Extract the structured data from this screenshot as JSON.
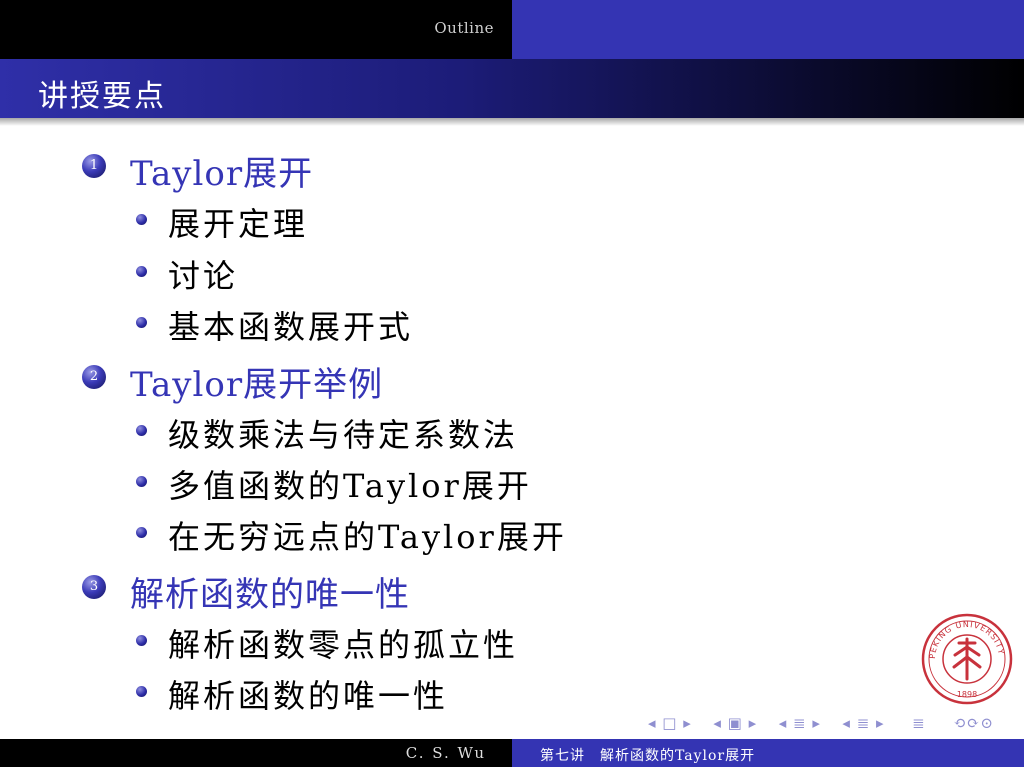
{
  "headline": {
    "text": "Outline"
  },
  "frame": {
    "title": "讲授要点"
  },
  "sections": [
    {
      "number": "1",
      "title": "Taylor展开",
      "items": [
        "展开定理",
        "讨论",
        "基本函数展开式"
      ]
    },
    {
      "number": "2",
      "title": "Taylor展开举例",
      "items": [
        "级数乘法与待定系数法",
        "多值函数的Taylor展开",
        "在无穷远点的Taylor展开"
      ]
    },
    {
      "number": "3",
      "title": "解析函数的唯一性",
      "items": [
        "解析函数零点的孤立性",
        "解析函数的唯一性"
      ]
    }
  ],
  "navigation": {
    "frame_nav": "◂ □ ▸",
    "subsection_nav": "◂ ▣ ▸",
    "section_nav": "◂ ≣ ▸",
    "subsub_nav": "◂ ≣ ▸",
    "outline": "≣",
    "search_controls": "⟲⟳⊙"
  },
  "seal": {
    "name": "Peking University seal",
    "top_text": "PEKING UNIVERSITY",
    "year": "1898"
  },
  "footer": {
    "author": "C. S. Wu",
    "title": "第七讲　解析函数的Taylor展开"
  },
  "colors": {
    "accent": "#3434b3",
    "bar_dark": "#000000",
    "seal_red": "#c8323c"
  }
}
